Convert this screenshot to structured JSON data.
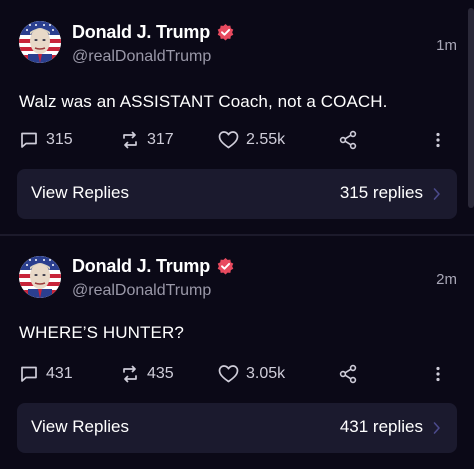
{
  "posts": [
    {
      "author_name": "Donald J. Trump",
      "handle": "@realDonaldTrump",
      "timestamp": "1m",
      "text": "Walz was an ASSISTANT Coach, not a COACH.",
      "comments": "315",
      "reposts": "317",
      "likes": "2.55k",
      "view_replies_label": "View Replies",
      "replies_count_label": "315 replies"
    },
    {
      "author_name": "Donald J. Trump",
      "handle": "@realDonaldTrump",
      "timestamp": "2m",
      "text": "WHERE’S HUNTER?",
      "comments": "431",
      "reposts": "435",
      "likes": "3.05k",
      "view_replies_label": "View Replies",
      "replies_count_label": "431 replies"
    }
  ],
  "icons": {
    "comment": "comment-icon",
    "repost": "repost-icon",
    "like": "heart-icon",
    "share": "share-icon",
    "more": "more-vertical-icon",
    "verified": "verified-badge-icon",
    "chevron": "chevron-right-icon"
  },
  "colors": {
    "background": "#0b0917",
    "card": "#1b1a2e",
    "verified": "#e84a5f",
    "muted_text": "#9a98a8",
    "chevron": "#4b4a8a"
  }
}
